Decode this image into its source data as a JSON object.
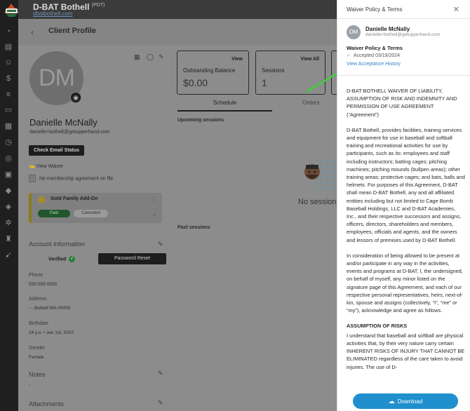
{
  "app": {
    "brand": "D-BAT Bothell",
    "timezone": "(PDT)",
    "site": "dbatbothell.com",
    "page_title": "Client Profile"
  },
  "nav_icons": [
    "dashboard-icon",
    "book-icon",
    "people-icon",
    "money-icon",
    "receipt-icon",
    "chat-icon",
    "calendar-icon",
    "gauge-icon",
    "globe-icon",
    "card-icon",
    "tag-icon",
    "tags-icon",
    "gear-icon",
    "trophy-icon",
    "rocket-icon"
  ],
  "client": {
    "initials": "DM",
    "name": "Danielle McNally",
    "email": "danielle+bothell@getupperhand.com",
    "check_email_label": "Check Email Status",
    "view_waiver_label": "View Waiver",
    "membership_note": "No membership agreement on file",
    "addon": {
      "name": "Gold Family Add-On",
      "paid_label": "Paid",
      "cancelled_label": "Cancelled"
    },
    "account_info_heading": "Account Information",
    "verified_label": "Verified",
    "password_reset_label": "Password Reset",
    "fields": [
      {
        "label": "Phone",
        "value": "555-555-5555"
      },
      {
        "label": "Address",
        "value": "--, Bothell WA 00000"
      },
      {
        "label": "Birthdate",
        "value": "24 y.o. • Jan 1st, 2002"
      },
      {
        "label": "Gender",
        "value": "Female"
      }
    ],
    "notes_heading": "Notes",
    "notes_value": "-",
    "attachments_heading": "Attachments"
  },
  "stats": {
    "outstanding": {
      "title": "Outstanding Balance",
      "value": "$0.00",
      "action": "View"
    },
    "sessions": {
      "title": "Sessions",
      "value": "1",
      "action": "View All"
    }
  },
  "tabs": {
    "schedule": "Schedule",
    "orders": "Orders"
  },
  "schedule": {
    "upcoming_label": "Upcoming sessions",
    "no_sessions": "No session",
    "past_label": "Past sessions"
  },
  "drawer": {
    "title": "Waiver Policy & Terms",
    "user_initials": "DM",
    "user_name": "Danielle McNally",
    "user_email": "danielle+bothell@getupperhand.com",
    "section_title": "Waiver Policy & Terms",
    "accepted": "Accepted 03/19/2024",
    "view_history": "View Acceptance History",
    "body": [
      "D-BAT BOTHELL WAIVER OF LIABILITY, ASSUMPTION OF RISK AND INDEMNITY AND PERMISSION OF USE AGREEMENT (“Agreement”)",
      "D-BAT Bothell, provides facilities, training services and equipment for use in baseball and softball training and recreational activities for use by participants, such as its:  employees and staff including instructors; batting cages; pitching machines; pitching mounds (bullpen areas); other training areas; protective cages; and bats, balls and helmets. For purposes of this Agreement, D-BAT shall mean D-BAT Bothell, any and all affiliated entities including but not limited to Cage Bomb Baseball Holdings, LLC and D-BAT Academies, Inc., and their respective successors and assigns, officers, directors, shareholders and members, employees, officials and agents, and the owners and lessors of premises used by D-BAT Bothell.",
      "In consideration of being allowed to be present at and/or participate in any way in the activities, events and programs at D-BAT, I, the undersigned, on behalf of myself, any minor listed on the signature page of this Agreement, and each of our respective personal representatives, heirs, next-of-kin, spouse and assigns (collectively, “I”, “me” or “my”), acknowledge and agree as follows."
    ],
    "risks_heading": "ASSUMPTION OF RISKS",
    "risks_text": "I understand that baseball and softball are physical activities that, by their very nature carry certain INHERENT RISKS OF INJURY THAT CANNOT BE ELIMINATED regardless of the care taken to avoid injuries. The use of D-",
    "download_label": "Download"
  },
  "colors": {
    "drawer_link": "#2f7fc4",
    "download_button": "#1f8fce",
    "annotation_arrow": "#3cd13c"
  }
}
